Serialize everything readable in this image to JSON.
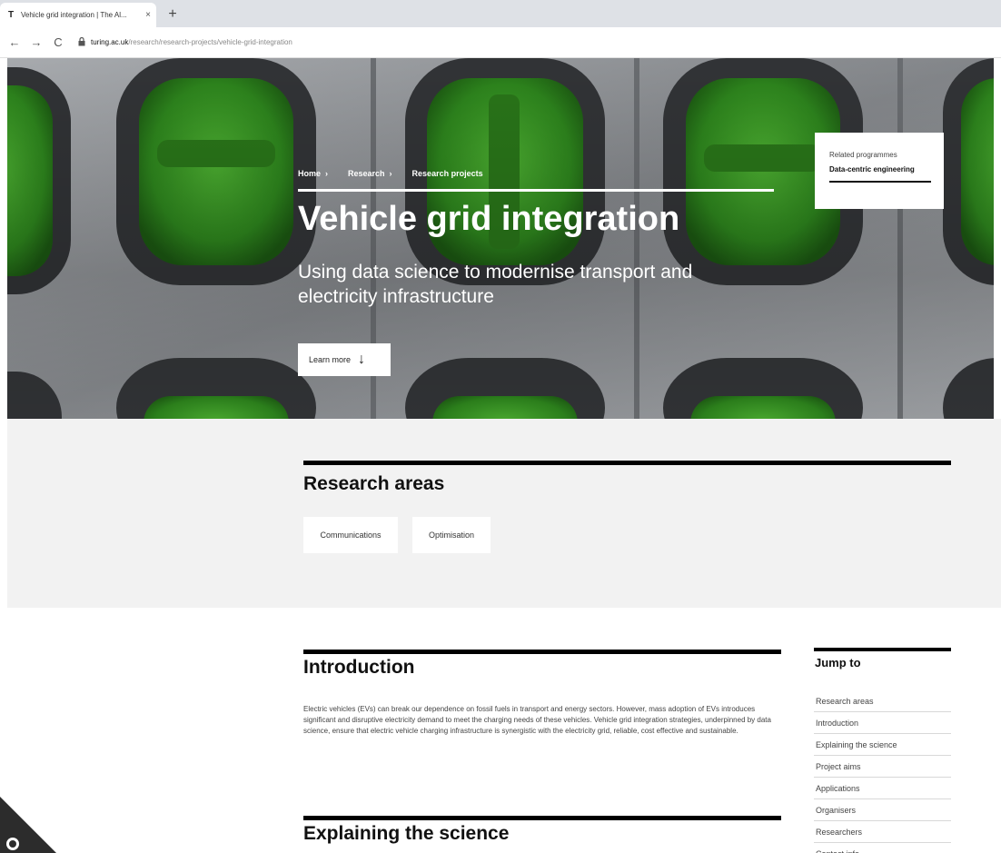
{
  "browser": {
    "tab_title": "Vehicle grid integration | The Al...",
    "tab_close": "×",
    "new_tab": "+",
    "back": "←",
    "forward": "→",
    "reload": "C",
    "lock_icon": "lock-icon",
    "url_host": "turing.ac.uk",
    "url_path": "/research/research-projects/vehicle-grid-integration"
  },
  "hero": {
    "breadcrumbs": [
      {
        "label": "Home"
      },
      {
        "label": "Research"
      },
      {
        "label": "Research projects"
      }
    ],
    "title": "Vehicle grid integration",
    "subtitle": "Using data science to modernise transport and electricity infrastructure",
    "learn_more": "Learn more",
    "learn_more_icon": "↓",
    "related": {
      "label": "Related programmes",
      "link": "Data-centric engineering"
    }
  },
  "research_areas": {
    "title": "Research areas",
    "chips": [
      "Communications",
      "Optimisation"
    ]
  },
  "introduction": {
    "title": "Introduction",
    "text": "Electric vehicles (EVs) can break our dependence on fossil fuels in transport and energy sectors. However, mass adoption of EVs introduces significant and disruptive electricity demand to meet the charging needs of these vehicles. Vehicle grid integration strategies, underpinned by data science, ensure that electric vehicle charging infrastructure is synergistic with the electricity grid, reliable, cost effective and sustainable."
  },
  "explaining": {
    "title": "Explaining the science"
  },
  "jump_to": {
    "title": "Jump to",
    "items": [
      "Research areas",
      "Introduction",
      "Explaining the science",
      "Project aims",
      "Applications",
      "Organisers",
      "Researchers",
      "Contact info"
    ]
  },
  "colors": {
    "accent_green": "#3a9a23",
    "rule_black": "#000000",
    "band_grey": "#f2f2f2"
  }
}
